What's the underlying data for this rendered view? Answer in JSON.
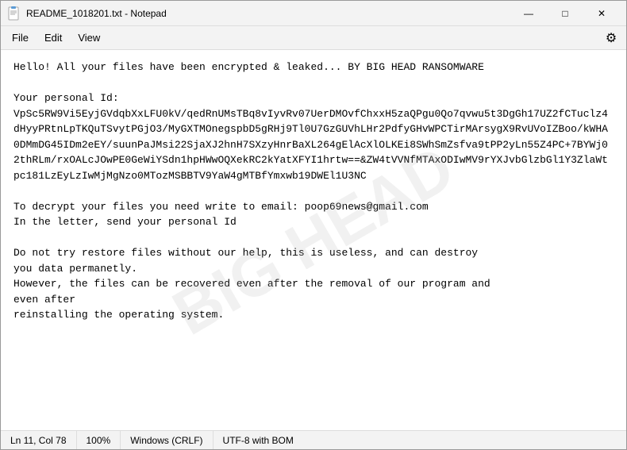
{
  "titleBar": {
    "title": "README_1018201.txt - Notepad",
    "minimize": "—",
    "maximize": "□",
    "close": "✕"
  },
  "menuBar": {
    "items": [
      "File",
      "Edit",
      "View"
    ],
    "gear": "⚙"
  },
  "content": {
    "text": "Hello! All your files have been encrypted & leaked... BY BIG HEAD RANSOMWARE\n\nYour personal Id:\nVpSc5RW9Vi5EyjGVdqbXxLFU0kV/qedRnUMsTBq8vIyvRv07UerDMOvfChxxH5zaQPgu0Qo7qvwu5t3DgGh17UZ2fCTuclz4dHyyPRtnLpTKQuTSvytPGjO3/MyGXTMOnegspbD5gRHj9Tl0U7GzGUVhLHr2PdfyGHvWPCTirMArsygX9RvUVoIZBoo/kWHA0DMmDG45IDm2eEY/suunPaJMsi22SjaXJ2hnH7SXzyHnrBaXL264gElAcXlOLKEi8SWhSmZsfva9tPP2yLn55Z4PC+7BYWj02thRLm/rxOALcJOwPE0GeWiYSdn1hpHWwOQXekRC2kYatXFYI1hrtw==&ZW4tVVNfMTAxODIwMV9rYXJvbGlzbGl1Y3ZlaWtpc181LzEyLzIwMjMgNzo0MTozMSBBTV9YaW4gMTBfYmxwb19DWEl1U3NC\n\nTo decrypt your files you need write to email: poop69news@gmail.com\nIn the letter, send your personal Id\n\nDo not try restore files without our help, this is useless, and can destroy\nyou data permanetly.\nHowever, the files can be recovered even after the removal of our program and\neven after\nreinstalling the operating system."
  },
  "statusBar": {
    "position": "Ln 11, Col 78",
    "zoom": "100%",
    "lineEnding": "Windows (CRLF)",
    "encoding": "UTF-8 with BOM"
  }
}
